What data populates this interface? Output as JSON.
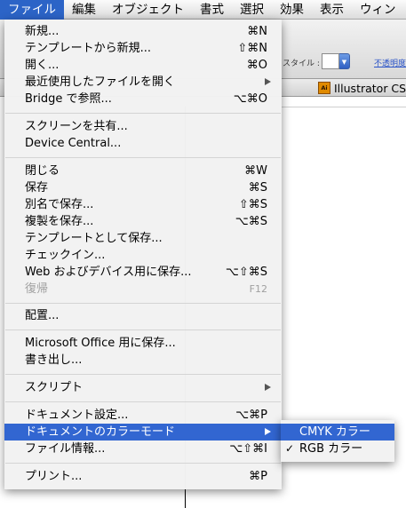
{
  "menubar": {
    "items": [
      "ファイル",
      "編集",
      "オブジェクト",
      "書式",
      "選択",
      "効果",
      "表示",
      "ウィン"
    ]
  },
  "toolbar": {
    "style_label": "スタイル :",
    "opacity_label": "不透明度"
  },
  "doc_tab": {
    "icon_text": "Ai",
    "label": "Illustrator CS"
  },
  "file_menu": {
    "items": [
      {
        "label": "新規...",
        "shortcut": "⌘N"
      },
      {
        "label": "テンプレートから新規...",
        "shortcut": "⇧⌘N"
      },
      {
        "label": "開く...",
        "shortcut": "⌘O"
      },
      {
        "label": "最近使用したファイルを開く",
        "shortcut": ""
      },
      {
        "label": "Bridge で参照...",
        "shortcut": "⌥⌘O"
      },
      {
        "label": "スクリーンを共有...",
        "shortcut": ""
      },
      {
        "label": "Device Central...",
        "shortcut": ""
      },
      {
        "label": "閉じる",
        "shortcut": "⌘W"
      },
      {
        "label": "保存",
        "shortcut": "⌘S"
      },
      {
        "label": "別名で保存...",
        "shortcut": "⇧⌘S"
      },
      {
        "label": "複製を保存...",
        "shortcut": "⌥⌘S"
      },
      {
        "label": "テンプレートとして保存...",
        "shortcut": ""
      },
      {
        "label": "チェックイン...",
        "shortcut": ""
      },
      {
        "label": "Web およびデバイス用に保存...",
        "shortcut": "⌥⇧⌘S"
      },
      {
        "label": "復帰",
        "shortcut": "F12"
      },
      {
        "label": "配置...",
        "shortcut": ""
      },
      {
        "label": "Microsoft Office 用に保存...",
        "shortcut": ""
      },
      {
        "label": "書き出し...",
        "shortcut": ""
      },
      {
        "label": "スクリプト",
        "shortcut": ""
      },
      {
        "label": "ドキュメント設定...",
        "shortcut": "⌥⌘P"
      },
      {
        "label": "ドキュメントのカラーモード",
        "shortcut": ""
      },
      {
        "label": "ファイル情報...",
        "shortcut": "⌥⇧⌘I"
      },
      {
        "label": "プリント...",
        "shortcut": "⌘P"
      }
    ]
  },
  "color_mode_submenu": {
    "items": [
      {
        "label": "CMYK カラー",
        "checked": false
      },
      {
        "label": "RGB カラー",
        "checked": true,
        "check_mark": "✓"
      }
    ]
  }
}
